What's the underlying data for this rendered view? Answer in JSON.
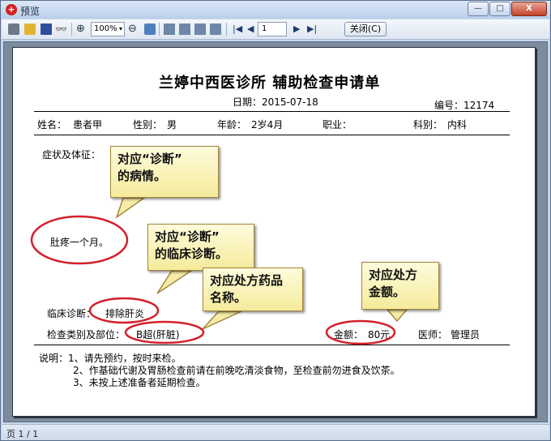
{
  "window": {
    "title": "预览",
    "min_glyph": "—",
    "max_glyph": "□",
    "close_glyph": "X"
  },
  "toolbar": {
    "find_glyph": "👓",
    "zoomin_glyph": "⊕",
    "zoomout_glyph": "⊖",
    "zoom_value": "100%",
    "zoom_arrow": "▾",
    "first_glyph": "|◀",
    "prev_glyph": "◀",
    "page_value": "1",
    "next_glyph": "▶",
    "last_glyph": "▶|",
    "close_label": "关闭(C)"
  },
  "document": {
    "title": "兰婷中西医诊所 辅助检查申请单",
    "date": "日期：2015-07-18",
    "number": "编号：12174",
    "name_label": "姓名：",
    "name_value": "患者甲",
    "gender_label": "性别：",
    "gender_value": "男",
    "age_label": "年龄：",
    "age_value": "2岁4月",
    "job_label": "职业：",
    "dept_label": "科别：",
    "dept_value": "内科",
    "symptom_label": "症状及体征：",
    "symptom_value": "肚疼一个月。",
    "diagnosis_label": "临床诊断：",
    "diagnosis_value": "排除肝炎",
    "exam_label": "检查类别及部位：",
    "exam_value": "B超(肝脏)",
    "amount_label": "金额：",
    "amount_value": "80元",
    "doctor_label": "医师：",
    "doctor_value": "管理员",
    "notes": [
      "说明：1、请先预约，按时来检。",
      "2、作基础代谢及胃肠检查前请在前晚吃清淡食物，至检查前勿进食及饮茶。",
      "3、未按上述准备者延期检查。"
    ]
  },
  "callouts": {
    "c1_l1": "对应“诊断”",
    "c1_l2": "的病情。",
    "c2_l1": "对应“诊断”",
    "c2_l2": "的临床诊断。",
    "c3_l1": "对应处方药品",
    "c3_l2": "名称。",
    "c4_l1": "对应处方",
    "c4_l2": "金额。"
  },
  "status": {
    "page_info": "页 1 / 1"
  },
  "colors": {
    "annotation_red": "#d3202a",
    "callout_fill": "#fbf3b5"
  }
}
